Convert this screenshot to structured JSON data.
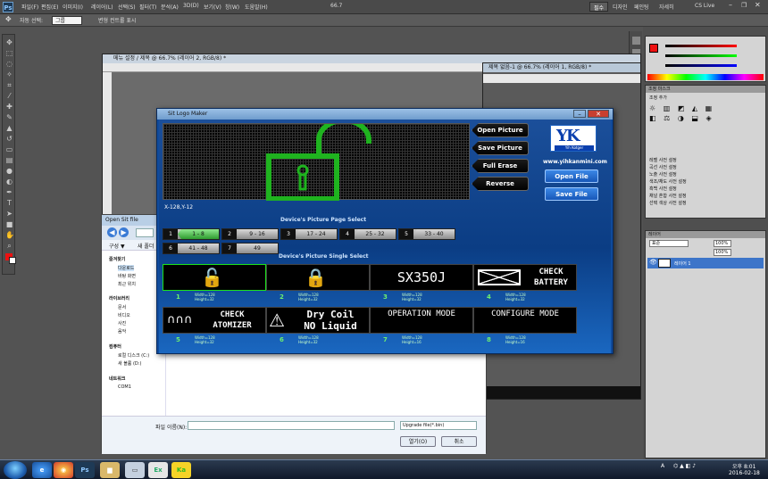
{
  "menubar": {
    "ps": "Ps",
    "items": [
      "파일(F)",
      "편집(E)",
      "이미지(I)",
      "레이어(L)",
      "선택(S)",
      "필터(T)",
      "분석(A)",
      "3D(D)",
      "보기(V)",
      "창(W)",
      "도움말(H)"
    ],
    "zoom": "66.7",
    "workspace": "필수",
    "workspace_items": [
      "디자인",
      "페인팅",
      "자세히"
    ],
    "cslive": "CS Live"
  },
  "optbar": {
    "label1": "자동 선택:",
    "dd1": "그룹",
    "label2": "변형 컨트롤 표시"
  },
  "docwin": {
    "title": "메뉴 설정 / 제목 @ 66.7% (레이어 2, RGB/8) *"
  },
  "docwin2": {
    "title": "제목 없음-1 @ 66.7% (레이어 1, RGB/8) *"
  },
  "openfile": {
    "title": "Open Sit file",
    "organize": "구성 ▼",
    "newfolder": "새 폴더",
    "side": [
      "즐겨찾기",
      "다운로드",
      "바탕 화면",
      "최근 위치",
      "라이브러리",
      "문서",
      "비디오",
      "사진",
      "음악",
      "컴퓨터",
      "로컬 디스크 (C:)",
      "새 볼륨 (D:)",
      "네트워크",
      "COM1"
    ],
    "filename_label": "파일 이름(N):",
    "filetype": "Upgrade file(*.bin)",
    "open": "열기(O)",
    "cancel": "취소"
  },
  "app": {
    "title": "Sit Logo Maker",
    "side_buttons": [
      "Open Picture",
      "Save Picture",
      "Full Erase",
      "Reverse"
    ],
    "brand_logo": "YK",
    "brand_sub": "Yih Kotger",
    "url": "www.yihkanmini.com",
    "open_file": "Open File",
    "save_file": "Save File",
    "coords": "X-128,Y-12",
    "page_select_title": "Device's Picture Page Select",
    "single_select_title": "Device's Picture Single Select",
    "pages": [
      {
        "num": "1",
        "range": "1 - 8"
      },
      {
        "num": "2",
        "range": "9 - 16"
      },
      {
        "num": "3",
        "range": "17 - 24"
      },
      {
        "num": "4",
        "range": "25 - 32"
      },
      {
        "num": "5",
        "range": "33 - 40"
      },
      {
        "num": "6",
        "range": "41 - 48"
      },
      {
        "num": "7",
        "range": "49"
      }
    ],
    "selected_page": 1,
    "tiles": [
      {
        "num": "1",
        "text": "",
        "w": "Width=128",
        "h": "Height=32"
      },
      {
        "num": "2",
        "text": "",
        "w": "Width=128",
        "h": "Height=32"
      },
      {
        "num": "3",
        "text": "SX350J",
        "w": "Width=128",
        "h": "Height=32"
      },
      {
        "num": "4",
        "text": "CHECK BATTERY",
        "w": "Width=128",
        "h": "Height=32"
      },
      {
        "num": "5",
        "text": "CHECK ATOMIZER",
        "w": "Width=128",
        "h": "Height=32"
      },
      {
        "num": "6",
        "text": "Dry Coil NO Liquid",
        "w": "Width=128",
        "h": "Height=32"
      },
      {
        "num": "7",
        "text": "OPERATION MODE",
        "w": "Width=128",
        "h": "Height=16"
      },
      {
        "num": "8",
        "text": "CONFIGURE MODE",
        "w": "Width=128",
        "h": "Height=16"
      }
    ],
    "selected_tile": 1
  },
  "rightpanel": {
    "adjust_tab": "조정",
    "mask_tab": "마스크",
    "adjust_label": "조정 추가",
    "presets": [
      "레벨 사전 설정",
      "곡선 사전 설정",
      "노출 사전 설정",
      "색조/채도 사전 설정",
      "흑백 사전 설정",
      "채널 혼합 사전 설정",
      "선택 색상 사전 설정"
    ],
    "layers_tab": "레이어",
    "blend": "표준",
    "opacity": "100%",
    "fill": "100%",
    "layer_name": "레이어 1"
  },
  "taskbar": {
    "apps": [
      "Ps",
      "",
      "",
      "Ex",
      "Ka"
    ],
    "lang": "A",
    "time": "오후 8:01",
    "date": "2016-02-18"
  },
  "colors": {
    "app_bg": "#0f4a9c",
    "accent_green": "#1ce21c",
    "ps_bg": "#535353"
  }
}
